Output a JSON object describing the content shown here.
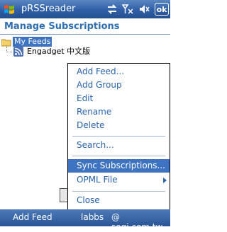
{
  "titlebar": {
    "app_title": "pRSSreader",
    "ok_label": "ok",
    "icons": [
      "windows-start-icon",
      "connectivity-icon",
      "signal-off-icon",
      "speaker-muted-icon"
    ]
  },
  "header": {
    "title": "Manage Subscriptions"
  },
  "tree": {
    "folder": {
      "label": "My Feeds",
      "icon": "folder-icon"
    },
    "feeds": [
      {
        "label": "Engadget 中文版",
        "icon": "rss-feed-icon"
      }
    ]
  },
  "menu": {
    "items": [
      {
        "label": "Add Feed..."
      },
      {
        "label": "Add Group"
      },
      {
        "label": "Edit"
      },
      {
        "label": "Rename"
      },
      {
        "label": "Delete"
      },
      {
        "label": "Search..."
      },
      {
        "label": "Sync Subscriptions..."
      },
      {
        "label": "OPML File"
      },
      {
        "label": "Close"
      }
    ],
    "selected_index": 6
  },
  "softkeys": {
    "left": "Add Feed",
    "middle": "labbs",
    "right": "@ sogi.com.tw"
  },
  "colors": {
    "accent": "#2e6fb3",
    "selection": "#3d73c0",
    "titlebar": "#2f5fa6",
    "menu_text": "#2a63ad"
  }
}
